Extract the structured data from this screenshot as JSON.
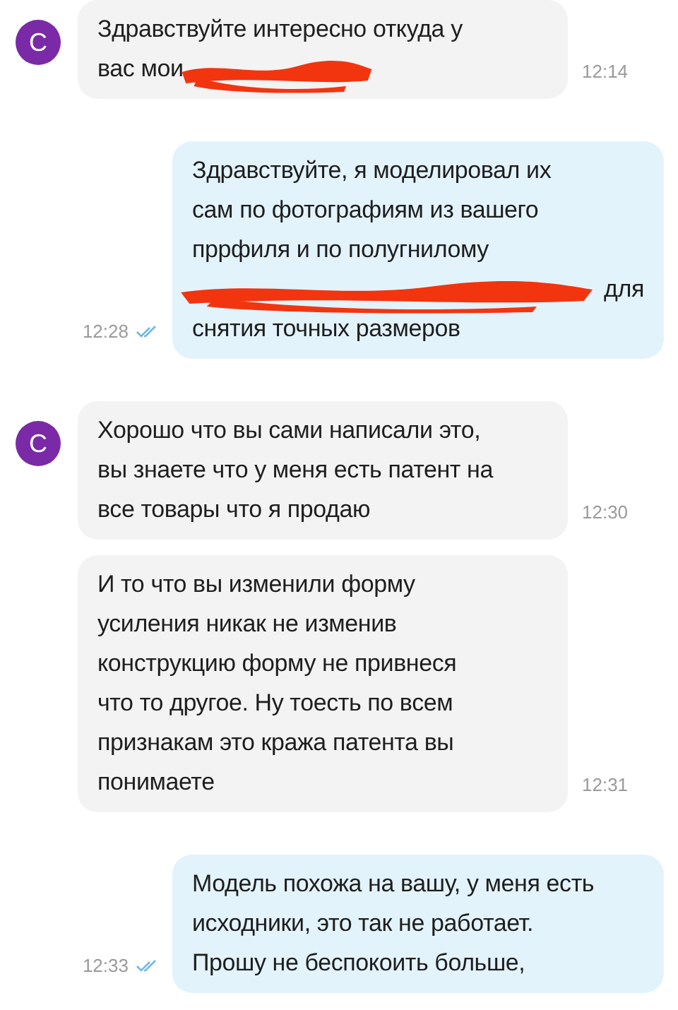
{
  "messages": [
    {
      "kind": "incoming",
      "avatar": "С",
      "lines": [
        {
          "text": "Здравствуйте интересно откуда у"
        },
        {
          "text": "вас мои",
          "redacted_after": true
        }
      ],
      "time": "12:14"
    },
    {
      "kind": "outgoing",
      "read": true,
      "lines": [
        {
          "text": "Здравствуйте, я моделировал их"
        },
        {
          "text": "сам по фотографиям из вашего"
        },
        {
          "text": "пррфиля и по полугнилому"
        },
        {
          "text": "для",
          "redacted_before": true
        },
        {
          "text": "снятия точных размеров"
        }
      ],
      "time": "12:28"
    },
    {
      "kind": "incoming",
      "avatar": "С",
      "lines": [
        {
          "text": "Хорошо что вы сами написали это,"
        },
        {
          "text": "вы знаете что у меня есть патент на"
        },
        {
          "text": "все товары что я продаю"
        }
      ],
      "time": "12:30"
    },
    {
      "kind": "incoming",
      "lines": [
        {
          "text": "И то что вы изменили форму"
        },
        {
          "text": "усиления никак не изменив"
        },
        {
          "text": "конструкцию форму не привнеся"
        },
        {
          "text": "что то другое. Ну тоесть по всем"
        },
        {
          "text": "признакам это кража патента вы"
        },
        {
          "text": "понимаете"
        }
      ],
      "time": "12:31"
    },
    {
      "kind": "outgoing",
      "read": true,
      "lines": [
        {
          "text": "Модель похожа на вашу, у меня есть"
        },
        {
          "text": "исходники, это так не работает."
        },
        {
          "text": "Прошу не беспокоить больше,"
        }
      ],
      "time": "12:33"
    }
  ]
}
